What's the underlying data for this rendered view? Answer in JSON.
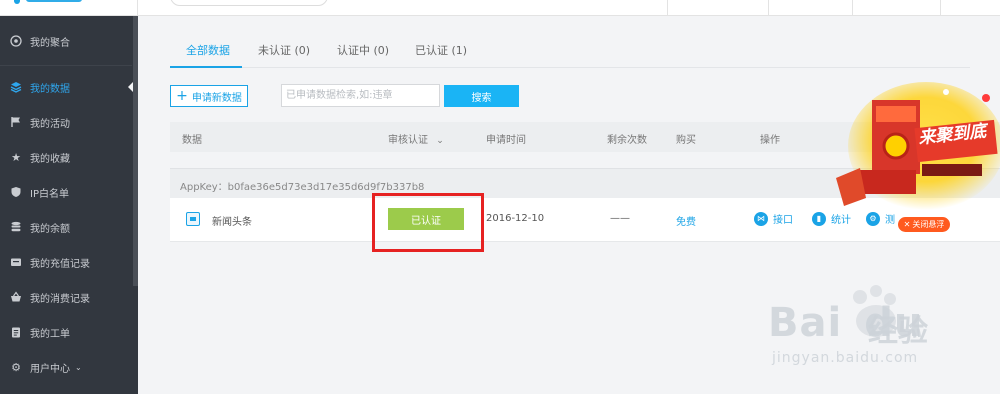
{
  "colors": {
    "accent": "#1aa3e6",
    "sidebar_bg": "#32373f",
    "certified": "#9ccb4b",
    "highlight": "#e62222",
    "close_btn": "#ff5a1f"
  },
  "sidebar": {
    "items": [
      {
        "label": "我的聚合",
        "icon": "settings-circle-icon"
      },
      {
        "label": "我的数据",
        "icon": "layers-icon",
        "active": true
      },
      {
        "label": "我的活动",
        "icon": "flag-icon"
      },
      {
        "label": "我的收藏",
        "icon": "star-icon"
      },
      {
        "label": "IP白名单",
        "icon": "shield-icon"
      },
      {
        "label": "我的余额",
        "icon": "database-icon"
      },
      {
        "label": "我的充值记录",
        "icon": "wallet-icon"
      },
      {
        "label": "我的消费记录",
        "icon": "basket-icon"
      },
      {
        "label": "我的工单",
        "icon": "clipboard-icon"
      },
      {
        "label": "用户中心",
        "icon": "gear-icon"
      }
    ]
  },
  "tabs": [
    {
      "label": "全部数据"
    },
    {
      "label": "未认证 (0)"
    },
    {
      "label": "认证中 (0)"
    },
    {
      "label": "已认证 (1)"
    }
  ],
  "toolbar": {
    "apply_label": "申请新数据",
    "search_placeholder": "已申请数据检索,如:违章",
    "search_label": "搜索"
  },
  "table": {
    "headers": [
      "数据",
      "审核认证",
      "申请时间",
      "剩余次数",
      "购买",
      "操作"
    ],
    "group": "AppKey：b0fae36e5d73e3d17e35d6d9f7b337b8",
    "row": {
      "name": "新闻头条",
      "status": "已认证",
      "date": "2016-12-10",
      "remaining": "——",
      "purchase": "免费",
      "ops": [
        "接口",
        "统计",
        "测"
      ]
    }
  },
  "promo": {
    "title": "来聚到底",
    "close_label": "关闭悬浮"
  },
  "watermark": {
    "brand": "Bai",
    "brand_tail": "du",
    "cn": "经验",
    "url": "jingyan.baidu.com"
  }
}
